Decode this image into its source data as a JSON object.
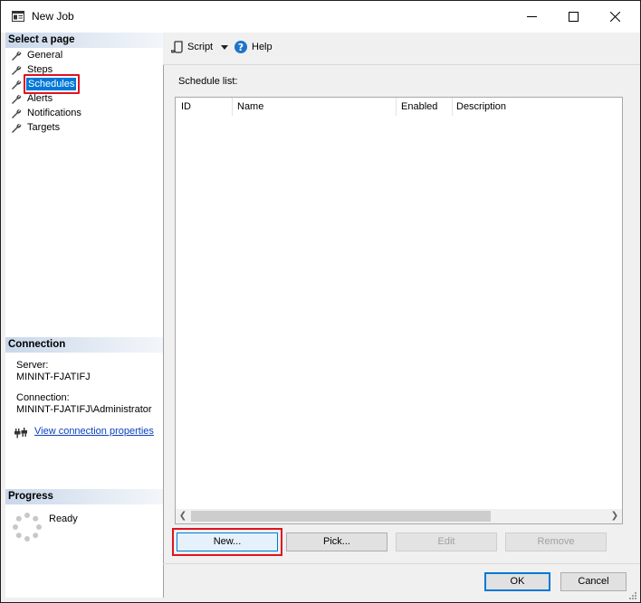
{
  "window": {
    "title": "New Job",
    "controls": {
      "minimize": "minimize",
      "maximize": "maximize",
      "close": "close"
    }
  },
  "left_panel": {
    "select_page_header": "Select a page",
    "pages": [
      {
        "label": "General",
        "icon": "wrench-icon",
        "selected": false
      },
      {
        "label": "Steps",
        "icon": "wrench-icon",
        "selected": false
      },
      {
        "label": "Schedules",
        "icon": "wrench-icon",
        "selected": true
      },
      {
        "label": "Alerts",
        "icon": "wrench-icon",
        "selected": false
      },
      {
        "label": "Notifications",
        "icon": "wrench-icon",
        "selected": false
      },
      {
        "label": "Targets",
        "icon": "wrench-icon",
        "selected": false
      }
    ],
    "connection_header": "Connection",
    "server_label": "Server:",
    "server_value": "MININT-FJATIFJ",
    "connection_label": "Connection:",
    "connection_value": "MININT-FJATIFJ\\Administrator",
    "view_connection_link": "View connection properties",
    "progress_header": "Progress",
    "progress_status": "Ready"
  },
  "toolbar": {
    "script_label": "Script",
    "help_label": "Help"
  },
  "schedule": {
    "list_label": "Schedule list:",
    "columns": [
      "ID",
      "Name",
      "Enabled",
      "Description"
    ],
    "rows": []
  },
  "buttons": {
    "new": "New...",
    "pick": "Pick...",
    "edit": "Edit",
    "remove": "Remove",
    "ok": "OK",
    "cancel": "Cancel"
  },
  "colors": {
    "selection": "#0078d7",
    "highlight_box": "#e0131f",
    "link": "#0a3fbd"
  }
}
